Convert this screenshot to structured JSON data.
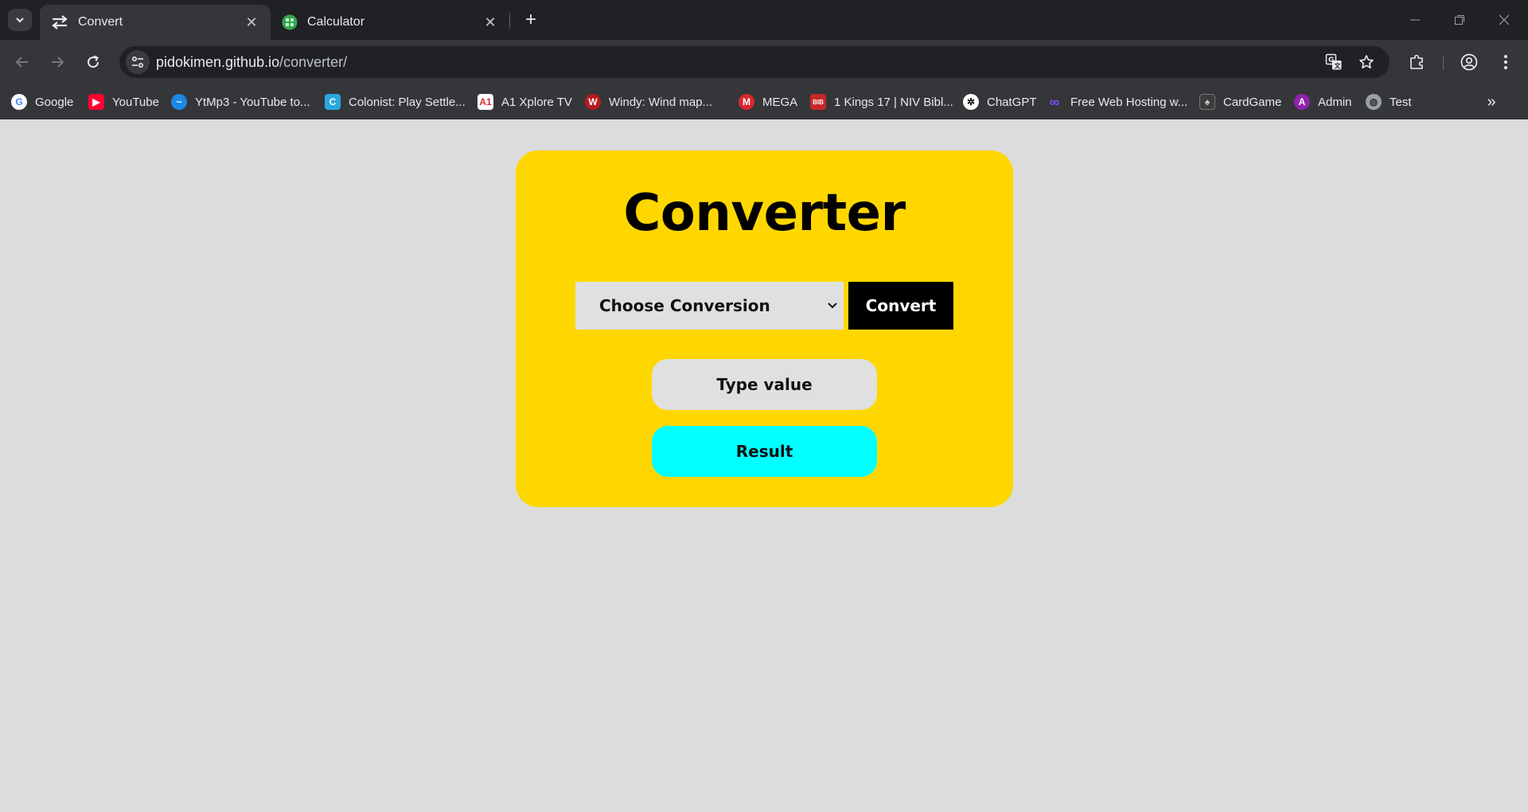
{
  "browser": {
    "tabs": [
      {
        "title": "Convert",
        "icon": "swap-arrows-icon",
        "active": true
      },
      {
        "title": "Calculator",
        "icon": "calculator-favicon",
        "active": false
      }
    ],
    "url_host": "pidokimen.github.io",
    "url_path": "/converter/",
    "bookmarks": [
      {
        "label": "Google",
        "icon": "google-favicon",
        "color": "#ffffff"
      },
      {
        "label": "YouTube",
        "icon": "youtube-favicon",
        "color": "#ff0033"
      },
      {
        "label": "YtMp3 - YouTube to...",
        "icon": "ytmp3-favicon",
        "color": "#1e88e5"
      },
      {
        "label": "Colonist: Play Settle...",
        "icon": "colonist-favicon",
        "color": "#29a8e0"
      },
      {
        "label": "A1 Xplore TV",
        "icon": "a1-favicon",
        "color": "#ffffff"
      },
      {
        "label": "Windy: Wind map...",
        "icon": "windy-favicon",
        "color": "#b71c1c"
      },
      {
        "label": "MEGA",
        "icon": "mega-favicon",
        "color": "#d9272e"
      },
      {
        "label": "1 Kings 17 | NIV Bibl...",
        "icon": "bible-favicon",
        "color": "#c62828"
      },
      {
        "label": "ChatGPT",
        "icon": "chatgpt-favicon",
        "color": "#ffffff"
      },
      {
        "label": "Free Web Hosting w...",
        "icon": "infinity-favicon",
        "color": "#7c4dff"
      },
      {
        "label": "CardGame",
        "icon": "cardgame-favicon",
        "color": "#9e9e9e"
      },
      {
        "label": "Admin",
        "icon": "admin-favicon",
        "color": "#8e24aa"
      },
      {
        "label": "Test",
        "icon": "globe-favicon",
        "color": "#9aa0a6"
      }
    ]
  },
  "page": {
    "title": "Converter",
    "select_value": "Choose Conversion",
    "convert_label": "Convert",
    "input_placeholder": "Type value",
    "result_label": "Result",
    "colors": {
      "background": "#dcdcdc",
      "card": "#ffd700",
      "result": "#00ffff",
      "convert_button": "#000000"
    }
  }
}
